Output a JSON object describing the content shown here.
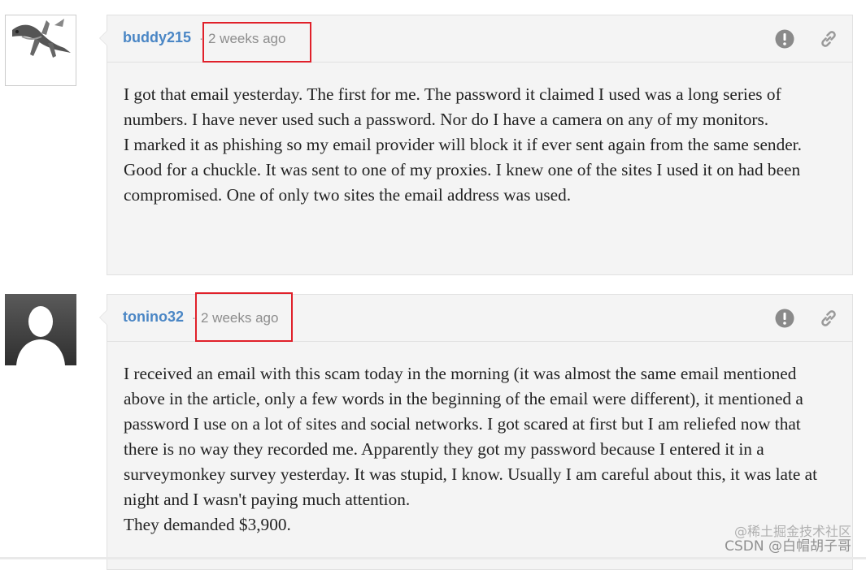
{
  "comments": [
    {
      "username": "buddy215",
      "separator": "·",
      "timestamp": "2 weeks ago",
      "avatar": "dragon-avatar",
      "actions": {
        "flag_icon": "alert-icon",
        "link_icon": "link-icon"
      },
      "paragraphs": [
        "I got that email yesterday. The first for me. The password it claimed I used was a long series of numbers. I have never used such a password. Nor do I have a camera on any of my monitors.",
        "I marked it as phishing so my email provider will block it if ever sent again from the same sender. Good for a chuckle. It was sent to one of my proxies. I knew one of the sites I used it on had been compromised. One of only two sites the email address was used."
      ]
    },
    {
      "username": "tonino32",
      "separator": "·",
      "timestamp": "2 weeks ago",
      "avatar": "default-user-avatar",
      "actions": {
        "flag_icon": "alert-icon",
        "link_icon": "link-icon"
      },
      "paragraphs": [
        "I received an email with this scam today in the morning (it was almost the same email mentioned above in the article, only a few words in the beginning of the email were different), it mentioned a password I use on a lot of sites and social networks. I got scared at first but I am reliefed now that there is no way they recorded me. Apparently they got my password because I entered it in a surveymonkey survey yesterday. It was stupid, I know. Usually I am careful about this, it was late at night and I wasn't paying much attention.",
        "They demanded $3,900."
      ]
    }
  ],
  "watermark": {
    "line1": "@稀土掘金技术社区",
    "line2": "CSDN @白帽胡子哥"
  },
  "colors": {
    "username": "#4a86c5",
    "highlight_box": "#e0202a",
    "card_bg": "#f4f4f4"
  }
}
